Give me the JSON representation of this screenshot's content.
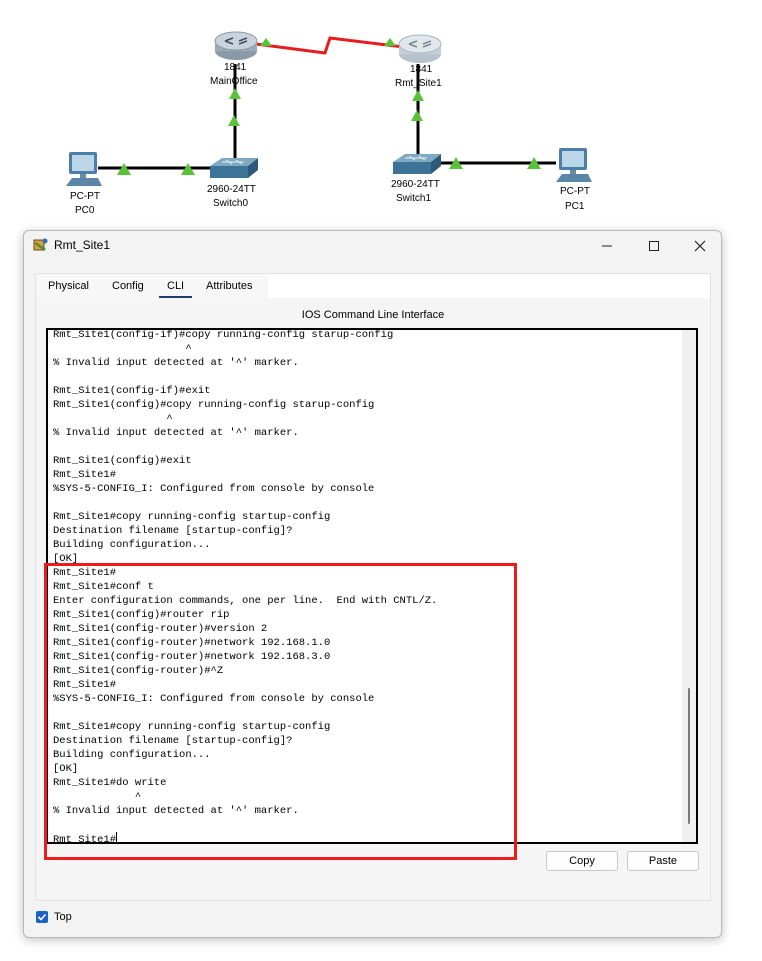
{
  "topology": {
    "devices": [
      {
        "model": "1841",
        "name": "MainOffice",
        "icon": "router-icon"
      },
      {
        "model": "1841",
        "name": "Rmt_Site1",
        "icon": "router-icon"
      },
      {
        "model": "2960-24TT",
        "name": "Switch0",
        "icon": "switch-icon"
      },
      {
        "model": "2960-24TT",
        "name": "Switch1",
        "icon": "switch-icon"
      },
      {
        "model": "PC-PT",
        "name": "PC0",
        "icon": "pc-icon"
      },
      {
        "model": "PC-PT",
        "name": "PC1",
        "icon": "pc-icon"
      }
    ],
    "link_colors": {
      "ethernet": "#000000",
      "serial": "#e81c1c",
      "link_up": "#5cc13a"
    }
  },
  "window": {
    "title": "Rmt_Site1",
    "controls": {
      "minimize": "minimize-icon",
      "maximize": "maximize-icon",
      "close": "close-icon"
    }
  },
  "tabs": [
    {
      "label": "Physical",
      "active": false
    },
    {
      "label": "Config",
      "active": false
    },
    {
      "label": "CLI",
      "active": true
    },
    {
      "label": "Attributes",
      "active": false
    }
  ],
  "cli": {
    "heading": "IOS Command Line Interface",
    "lines": [
      "Rmt_Site1(config-if)#copy running-config starup-config",
      "                     ^",
      "% Invalid input detected at '^' marker.",
      "",
      "Rmt_Site1(config-if)#exit",
      "Rmt_Site1(config)#copy running-config starup-config",
      "                  ^",
      "% Invalid input detected at '^' marker.",
      "",
      "Rmt_Site1(config)#exit",
      "Rmt_Site1#",
      "%SYS-5-CONFIG_I: Configured from console by console",
      "",
      "Rmt_Site1#copy running-config startup-config",
      "Destination filename [startup-config]?",
      "Building configuration...",
      "[OK]",
      "Rmt_Site1#",
      "Rmt_Site1#conf t",
      "Enter configuration commands, one per line.  End with CNTL/Z.",
      "Rmt_Site1(config)#router rip",
      "Rmt_Site1(config-router)#version 2",
      "Rmt_Site1(config-router)#network 192.168.1.0",
      "Rmt_Site1(config-router)#network 192.168.3.0",
      "Rmt_Site1(config-router)#^Z",
      "Rmt_Site1#",
      "%SYS-5-CONFIG_I: Configured from console by console",
      "",
      "Rmt_Site1#copy running-config startup-config",
      "Destination filename [startup-config]?",
      "Building configuration...",
      "[OK]",
      "Rmt_Site1#do write",
      "             ^",
      "% Invalid input detected at '^' marker.",
      ""
    ],
    "prompt": "Rmt_Site1#"
  },
  "buttons": {
    "copy": "Copy",
    "paste": "Paste"
  },
  "top_option": {
    "label": "Top",
    "checked": true
  },
  "highlight_color": "#ea1c1c"
}
